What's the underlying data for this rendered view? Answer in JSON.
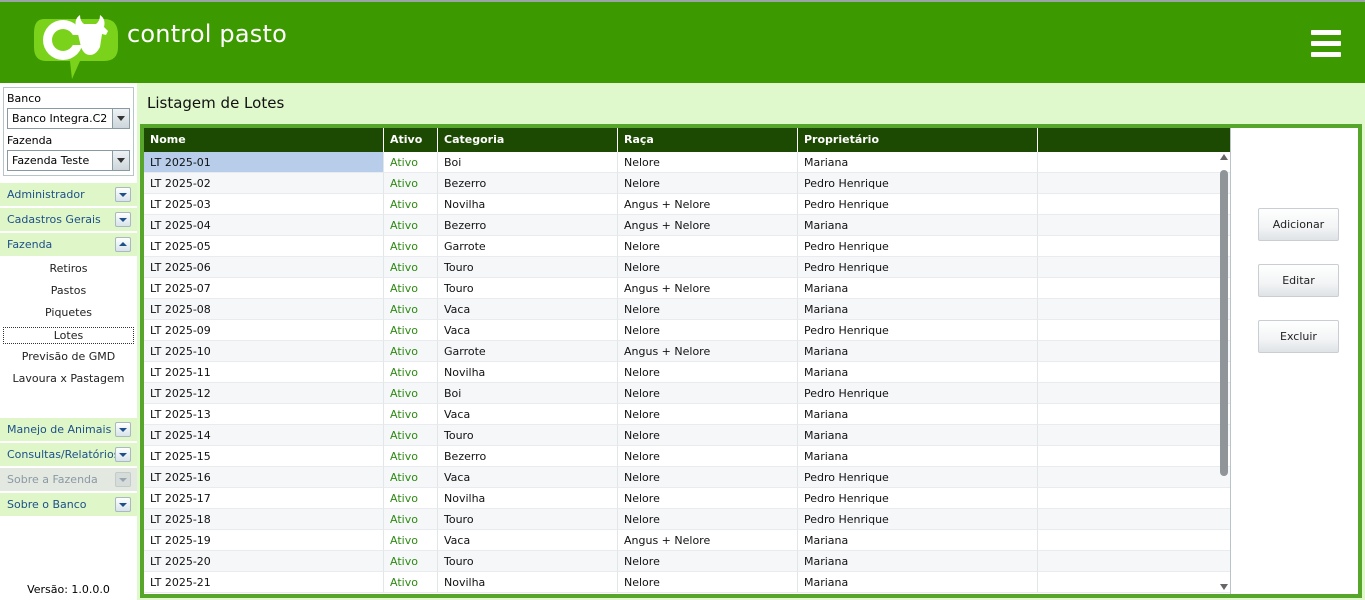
{
  "header": {
    "logo_text": "control pasto",
    "brand_color": "#3c9a00",
    "menu_icon": "hamburger-icon"
  },
  "sidebar": {
    "banco_label": "Banco",
    "banco_value": "Banco Integra.C2",
    "fazenda_label": "Fazenda",
    "fazenda_value": "Fazenda Teste",
    "menu": [
      {
        "label": "Administrador",
        "state": "collapsed"
      },
      {
        "label": "Cadastros Gerais",
        "state": "collapsed"
      },
      {
        "label": "Fazenda",
        "state": "expanded"
      },
      {
        "label": "Manejo de Animais",
        "state": "collapsed"
      },
      {
        "label": "Consultas/Relatórios",
        "state": "collapsed"
      },
      {
        "label": "Sobre a Fazenda",
        "state": "disabled"
      },
      {
        "label": "Sobre o Banco",
        "state": "collapsed"
      }
    ],
    "fazenda_items": [
      "Retiros",
      "Pastos",
      "Piquetes",
      "Lotes",
      "Previsão de GMD",
      "Lavoura x Pastagem"
    ],
    "active_item": "Lotes",
    "version": "Versão: 1.0.0.0"
  },
  "main": {
    "title": "Listagem de Lotes",
    "columns": [
      "Nome",
      "Ativo",
      "Categoria",
      "Raça",
      "Proprietário",
      ""
    ],
    "rows": [
      [
        "LT 2025-01",
        "Ativo",
        "Boi",
        "Nelore",
        "Mariana"
      ],
      [
        "LT 2025-02",
        "Ativo",
        "Bezerro",
        "Nelore",
        "Pedro Henrique"
      ],
      [
        "LT 2025-03",
        "Ativo",
        "Novilha",
        "Angus + Nelore",
        "Pedro Henrique"
      ],
      [
        "LT 2025-04",
        "Ativo",
        "Bezerro",
        "Angus + Nelore",
        "Mariana"
      ],
      [
        "LT 2025-05",
        "Ativo",
        "Garrote",
        "Nelore",
        "Pedro Henrique"
      ],
      [
        "LT 2025-06",
        "Ativo",
        "Touro",
        "Nelore",
        "Pedro Henrique"
      ],
      [
        "LT 2025-07",
        "Ativo",
        "Touro",
        "Angus + Nelore",
        "Mariana"
      ],
      [
        "LT 2025-08",
        "Ativo",
        "Vaca",
        "Nelore",
        "Mariana"
      ],
      [
        "LT 2025-09",
        "Ativo",
        "Vaca",
        "Nelore",
        "Pedro Henrique"
      ],
      [
        "LT 2025-10",
        "Ativo",
        "Garrote",
        "Angus + Nelore",
        "Mariana"
      ],
      [
        "LT 2025-11",
        "Ativo",
        "Novilha",
        "Nelore",
        "Mariana"
      ],
      [
        "LT 2025-12",
        "Ativo",
        "Boi",
        "Nelore",
        "Pedro Henrique"
      ],
      [
        "LT 2025-13",
        "Ativo",
        "Vaca",
        "Nelore",
        "Mariana"
      ],
      [
        "LT 2025-14",
        "Ativo",
        "Touro",
        "Nelore",
        "Mariana"
      ],
      [
        "LT 2025-15",
        "Ativo",
        "Bezerro",
        "Nelore",
        "Mariana"
      ],
      [
        "LT 2025-16",
        "Ativo",
        "Vaca",
        "Nelore",
        "Pedro Henrique"
      ],
      [
        "LT 2025-17",
        "Ativo",
        "Novilha",
        "Nelore",
        "Pedro Henrique"
      ],
      [
        "LT 2025-18",
        "Ativo",
        "Touro",
        "Nelore",
        "Pedro Henrique"
      ],
      [
        "LT 2025-19",
        "Ativo",
        "Vaca",
        "Angus + Nelore",
        "Mariana"
      ],
      [
        "LT 2025-20",
        "Ativo",
        "Touro",
        "Nelore",
        "Mariana"
      ],
      [
        "LT 2025-21",
        "Ativo",
        "Novilha",
        "Nelore",
        "Mariana"
      ]
    ],
    "selected_row": 0,
    "actions": {
      "add_label": "Adicionar",
      "edit_label": "Editar",
      "delete_label": "Excluir"
    }
  }
}
